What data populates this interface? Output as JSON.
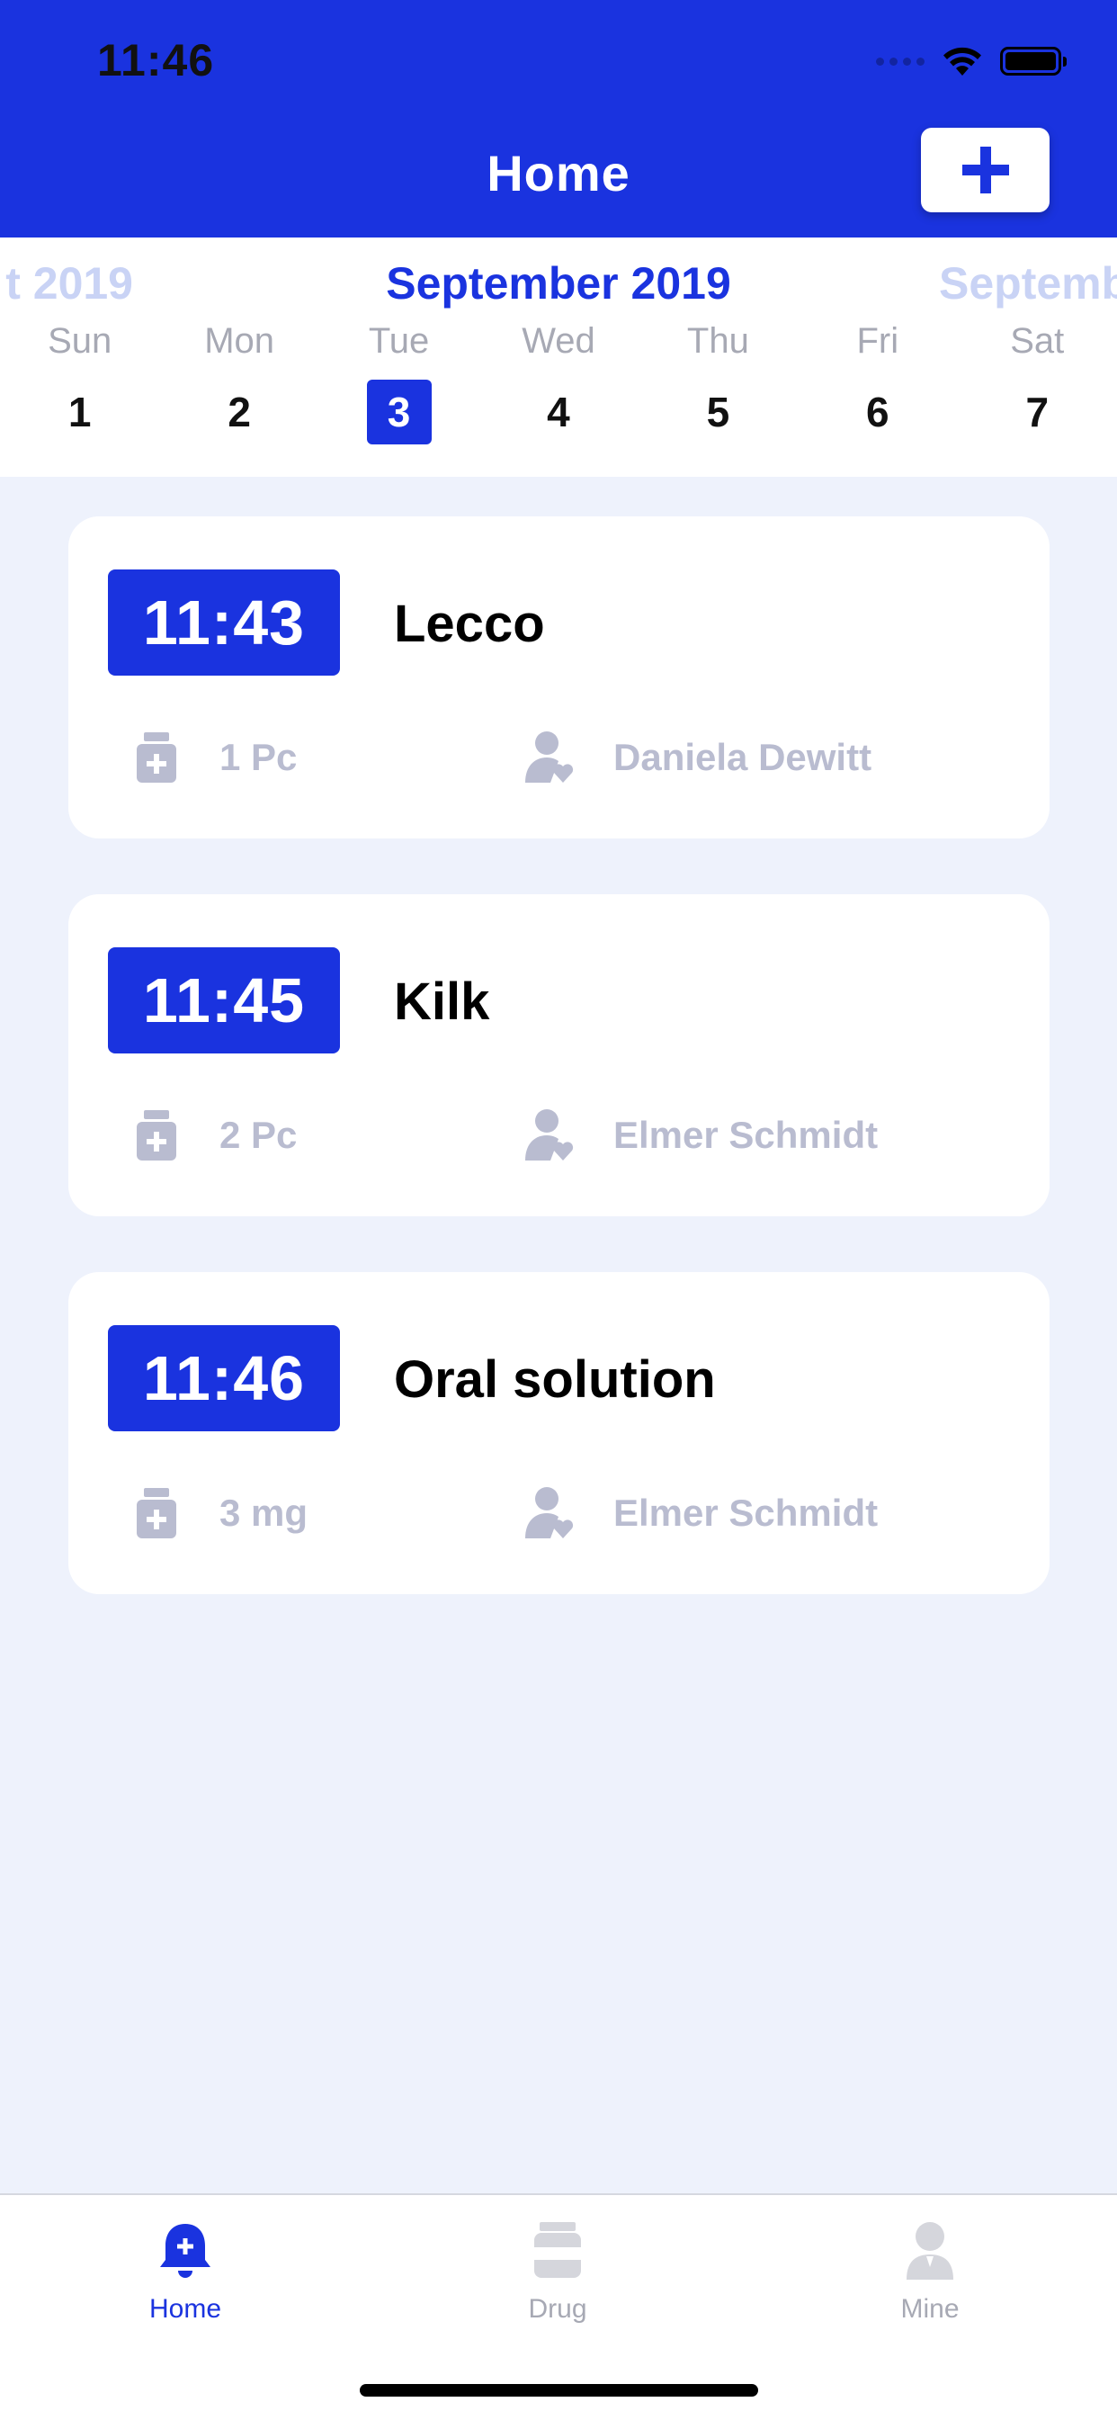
{
  "status_bar": {
    "time": "11:46"
  },
  "header": {
    "title": "Home",
    "add_button_icon": "plus-icon"
  },
  "calendar": {
    "prev_month": "t 2019",
    "current_month": "September 2019",
    "next_month": "Septemb",
    "days": [
      {
        "name": "Sun",
        "num": "1"
      },
      {
        "name": "Mon",
        "num": "2"
      },
      {
        "name": "Tue",
        "num": "3"
      },
      {
        "name": "Wed",
        "num": "4"
      },
      {
        "name": "Thu",
        "num": "5"
      },
      {
        "name": "Fri",
        "num": "6"
      },
      {
        "name": "Sat",
        "num": "7"
      }
    ],
    "selected_day": "3"
  },
  "reminders": [
    {
      "time": "11:43",
      "drug": "Lecco",
      "dose": "1 Pc",
      "person": "Daniela Dewitt"
    },
    {
      "time": "11:45",
      "drug": "Kilk",
      "dose": "2 Pc",
      "person": "Elmer Schmidt"
    },
    {
      "time": "11:46",
      "drug": "Oral solution",
      "dose": "3 mg",
      "person": "Elmer Schmidt"
    }
  ],
  "tabbar": {
    "tabs": [
      {
        "label": "Home",
        "icon": "bell-plus-icon",
        "active": true
      },
      {
        "label": "Drug",
        "icon": "pill-bottle-icon",
        "active": false
      },
      {
        "label": "Mine",
        "icon": "person-icon",
        "active": false
      }
    ]
  },
  "colors": {
    "primary": "#1A33DF",
    "background": "#EEF2FC",
    "muted_text": "#B9BCD0",
    "day_name": "#A7A9B4"
  }
}
